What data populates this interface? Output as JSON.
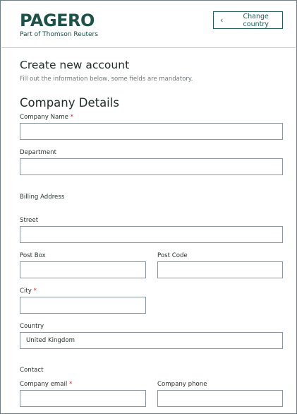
{
  "brand": {
    "logo_text": "PAGERO",
    "tagline": "Part of Thomson Reuters"
  },
  "header": {
    "change_country_label": "Change country"
  },
  "page": {
    "title": "Create new account",
    "subtitle": "Fill out the information below, some fields are mandatory."
  },
  "company_details": {
    "heading": "Company Details",
    "company_name_label": "Company Name",
    "company_name_value": "",
    "department_label": "Department",
    "department_value": ""
  },
  "billing_address": {
    "heading": "Billing Address",
    "street_label": "Street",
    "street_value": "",
    "post_box_label": "Post Box",
    "post_box_value": "",
    "post_code_label": "Post Code",
    "post_code_value": "",
    "city_label": "City",
    "city_value": "",
    "country_label": "Country",
    "country_value": "United Kingdom"
  },
  "contact": {
    "heading": "Contact",
    "email_label": "Company email",
    "email_value": "",
    "phone_label": "Company phone",
    "phone_value": ""
  },
  "required_marker": "*",
  "colors": {
    "brand": "#1e5249",
    "required": "#c2272d",
    "border": "#8b969c"
  },
  "icons": {
    "change_country": "chevron-left-icon"
  }
}
